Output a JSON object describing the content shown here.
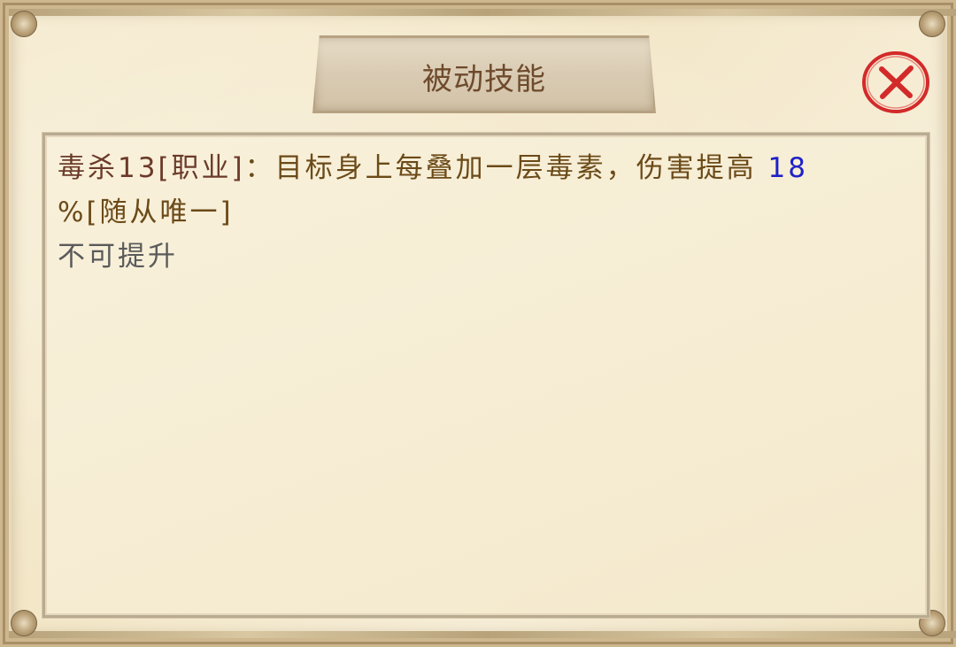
{
  "dialog": {
    "title": "被动技能",
    "close_icon": "close-x-icon",
    "accent_title_color": "#6e4a2c",
    "close_color": "#d32a2a"
  },
  "skill": {
    "name": "毒杀13[职业]",
    "separator": "：",
    "description": "目标身上每叠加一层毒素，伤害提高",
    "value": "18",
    "value_color": "#1e22c9",
    "suffix": "%[随从唯一]",
    "upgrade_status": "不可提升"
  }
}
